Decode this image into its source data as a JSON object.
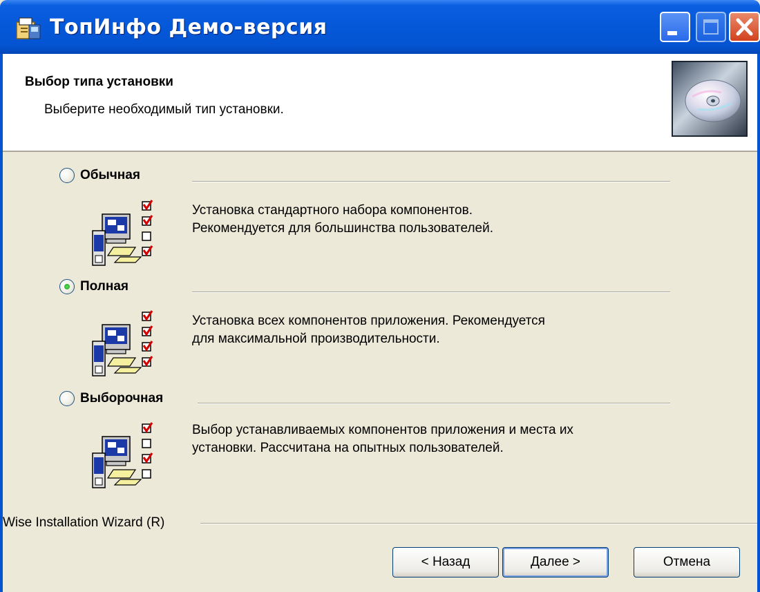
{
  "window": {
    "title": "ТопИнфо Демо-версия"
  },
  "header": {
    "title": "Выбор типа установки",
    "subtitle": "Выберите необходимый тип установки."
  },
  "options": [
    {
      "label": "Обычная",
      "selected": false,
      "description_line1": "Установка стандартного набора компонентов.",
      "description_line2": "Рекомендуется для большинства пользователей."
    },
    {
      "label": "Полная",
      "selected": true,
      "description_line1": "Установка всех компонентов приложения. Рекомендуется",
      "description_line2": "для максимальной производительности."
    },
    {
      "label": "Выборочная",
      "selected": false,
      "description_line1": "Выбор устанавливаемых компонентов приложения и места их",
      "description_line2": "установки. Рассчитана на опытных пользователей."
    }
  ],
  "footer": {
    "brand": "Wise Installation Wizard (R)",
    "back_label": "< Назад",
    "next_label": "Далее >",
    "cancel_label": "Отмена"
  },
  "icons": {
    "app": "installer-icon",
    "header_art": "cd-disc-icon",
    "option": "computer-checklist-icon"
  },
  "colors": {
    "titlebar": "#0454d2",
    "dialog_bg": "#ece9d8",
    "header_bg": "#ffffff",
    "radio_checked": "#1f9a1f",
    "check_red": "#d40000"
  }
}
